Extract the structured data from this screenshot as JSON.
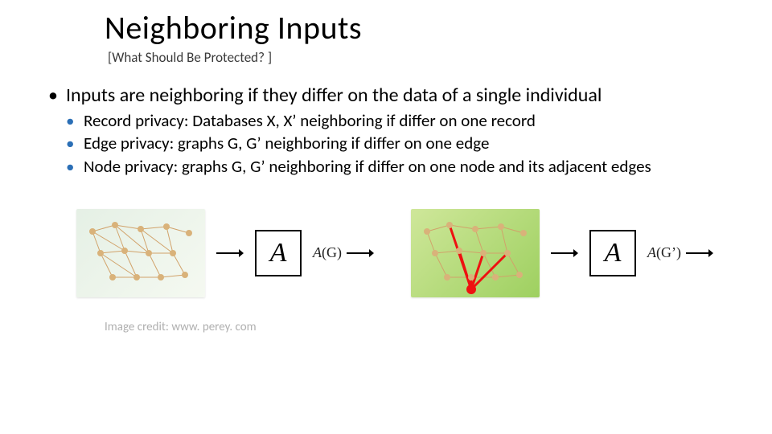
{
  "title": "Neighboring Inputs",
  "subtitle": "[What Should Be Protected? ]",
  "bullets": {
    "main": "Inputs are neighboring if they differ on the data of a single individual",
    "sub": [
      "Record privacy: Databases X, X’ neighboring if differ on one record",
      "Edge privacy: graphs G, G’ neighboring if differ on one edge",
      "Node privacy: graphs G, G’ neighboring if differ on one node and its adjacent edges"
    ]
  },
  "fig": {
    "algo": "A",
    "out_left_A": "A",
    "out_left_G": "(G)",
    "out_right_A": "A",
    "out_right_G": "(G’)"
  },
  "credit": "Image credit: www. perey. com"
}
